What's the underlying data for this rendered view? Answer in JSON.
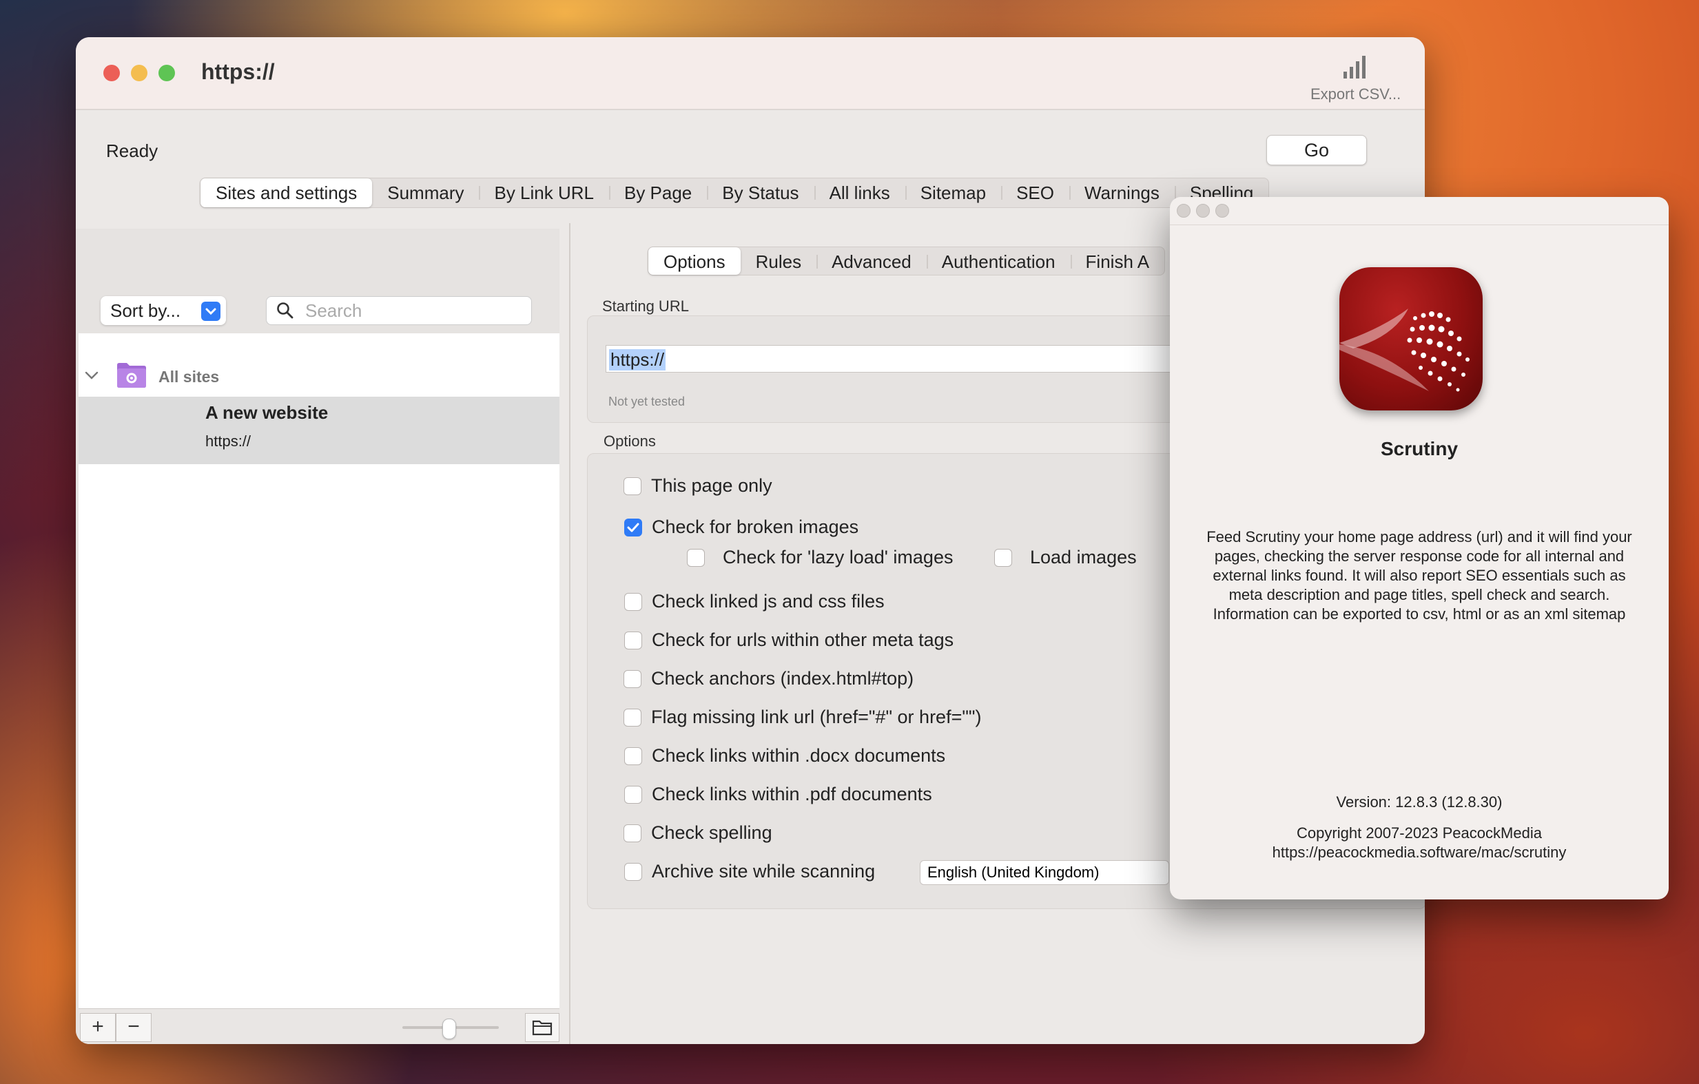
{
  "window": {
    "title": "https://",
    "export_label": "Export CSV...",
    "status": "Ready",
    "go_label": "Go"
  },
  "main_tabs": [
    "Sites and settings",
    "Summary",
    "By Link URL",
    "By Page",
    "By Status",
    "All links",
    "Sitemap",
    "SEO",
    "Warnings",
    "Spelling"
  ],
  "sidebar": {
    "sort_label": "Sort by...",
    "search_placeholder": "Search",
    "group_label": "All sites",
    "site": {
      "name": "A new website",
      "url": "https://"
    },
    "add_label": "+",
    "remove_label": "−"
  },
  "sub_tabs": [
    "Options",
    "Rules",
    "Advanced",
    "Authentication",
    "Finish A"
  ],
  "starting_url": {
    "label": "Starting URL",
    "value": "https://",
    "test_status": "Not yet tested"
  },
  "options": {
    "label": "Options",
    "items": [
      {
        "label": "This page only",
        "checked": false
      },
      {
        "label": "Check for broken images",
        "checked": true
      },
      {
        "label": "Check for 'lazy load' images",
        "checked": false
      },
      {
        "label": "Load images",
        "checked": false
      },
      {
        "label": "Check linked js and css files",
        "checked": false
      },
      {
        "label": "Check for urls within other meta tags",
        "checked": false
      },
      {
        "label": "Check anchors (index.html#top)",
        "checked": false
      },
      {
        "label": "Flag missing link url (href=\"#\" or href=\"\")",
        "checked": false
      },
      {
        "label": "Check links within .docx documents",
        "checked": false
      },
      {
        "label": "Check links within .pdf documents",
        "checked": false
      },
      {
        "label": "Check spelling",
        "checked": false
      },
      {
        "label": "Archive site while scanning",
        "checked": false
      }
    ],
    "spelling_language": "English (United Kingdom)"
  },
  "about": {
    "app_name": "Scrutiny",
    "description": "Feed Scrutiny your home page address (url) and it will  find your pages, checking the server response code for all internal and external links found. It will also report SEO essentials such as meta description and page titles, spell check and search. Information can be exported to csv, html or as an xml sitemap",
    "version": "Version:  12.8.3 (12.8.30)",
    "copyright": "Copyright 2007-2023 PeacockMedia",
    "url": "https://peacockmedia.software/mac/scrutiny"
  },
  "colors": {
    "accent": "#2f7bf6",
    "close": "#ec5f57",
    "minimize": "#f4bd4f",
    "zoom": "#5ec454",
    "folder": "#a26ad6",
    "selection": "#b3d1fb",
    "app_icon": "#8e1010"
  },
  "icons": [
    "signal-bars-icon",
    "chevron-down-icon",
    "search-icon",
    "folder-gear-icon",
    "disclosure-chevron-icon",
    "folder-icon",
    "checkmark-icon"
  ]
}
